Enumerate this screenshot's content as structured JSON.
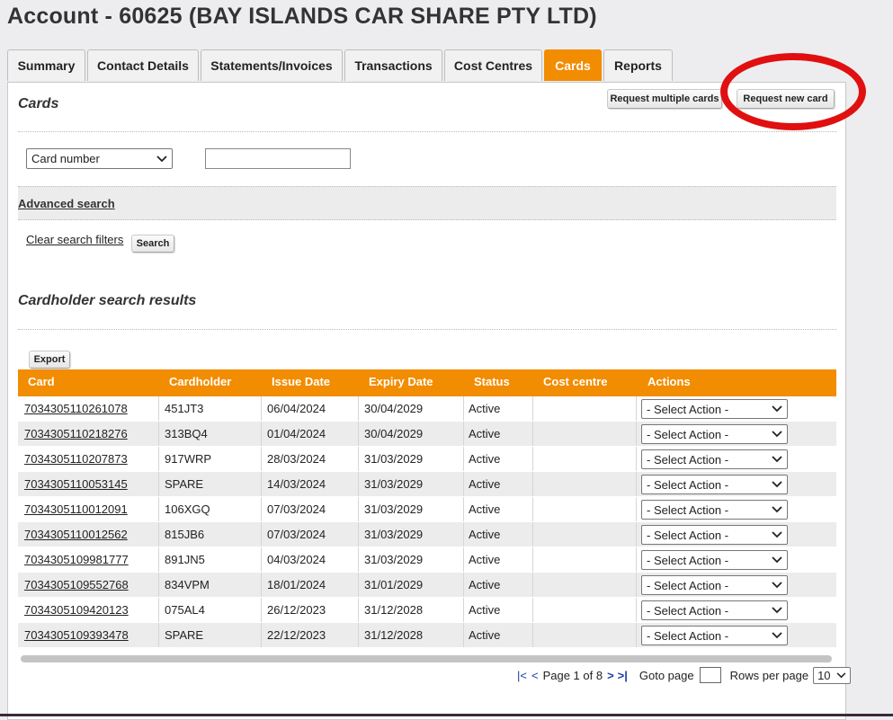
{
  "page_title": "Account - 60625 (BAY ISLANDS CAR SHARE PTY LTD)",
  "tabs": [
    {
      "label": "Summary",
      "active": false
    },
    {
      "label": "Contact Details",
      "active": false
    },
    {
      "label": "Statements/Invoices",
      "active": false
    },
    {
      "label": "Transactions",
      "active": false
    },
    {
      "label": "Cost Centres",
      "active": false
    },
    {
      "label": "Cards",
      "active": true
    },
    {
      "label": "Reports",
      "active": false
    }
  ],
  "cards_section": {
    "heading": "Cards",
    "request_multiple_label": "Request multiple cards",
    "request_new_label": "Request new card"
  },
  "search": {
    "field_select_value": "Card number",
    "input_value": "",
    "advanced_search_label": "Advanced search",
    "clear_filters_label": "Clear search filters",
    "search_button_label": "Search"
  },
  "results": {
    "heading": "Cardholder search results",
    "export_label": "Export",
    "columns": [
      "Card",
      "Cardholder",
      "Issue Date",
      "Expiry Date",
      "Status",
      "Cost centre",
      "Actions"
    ],
    "action_placeholder": "- Select Action -",
    "rows": [
      {
        "card": "7034305110261078",
        "cardholder": "451JT3",
        "issue": "06/04/2024",
        "expiry": "30/04/2029",
        "status": "Active",
        "cost_centre": ""
      },
      {
        "card": "7034305110218276",
        "cardholder": "313BQ4",
        "issue": "01/04/2024",
        "expiry": "30/04/2029",
        "status": "Active",
        "cost_centre": ""
      },
      {
        "card": "7034305110207873",
        "cardholder": "917WRP",
        "issue": "28/03/2024",
        "expiry": "31/03/2029",
        "status": "Active",
        "cost_centre": ""
      },
      {
        "card": "7034305110053145",
        "cardholder": "SPARE",
        "issue": "14/03/2024",
        "expiry": "31/03/2029",
        "status": "Active",
        "cost_centre": ""
      },
      {
        "card": "7034305110012091",
        "cardholder": "106XGQ",
        "issue": "07/03/2024",
        "expiry": "31/03/2029",
        "status": "Active",
        "cost_centre": ""
      },
      {
        "card": "7034305110012562",
        "cardholder": "815JB6",
        "issue": "07/03/2024",
        "expiry": "31/03/2029",
        "status": "Active",
        "cost_centre": ""
      },
      {
        "card": "7034305109981777",
        "cardholder": "891JN5",
        "issue": "04/03/2024",
        "expiry": "31/03/2029",
        "status": "Active",
        "cost_centre": ""
      },
      {
        "card": "7034305109552768",
        "cardholder": "834VPM",
        "issue": "18/01/2024",
        "expiry": "31/01/2029",
        "status": "Active",
        "cost_centre": ""
      },
      {
        "card": "7034305109420123",
        "cardholder": "075AL4",
        "issue": "26/12/2023",
        "expiry": "31/12/2028",
        "status": "Active",
        "cost_centre": ""
      },
      {
        "card": "7034305109393478",
        "cardholder": "SPARE",
        "issue": "22/12/2023",
        "expiry": "31/12/2028",
        "status": "Active",
        "cost_centre": ""
      }
    ]
  },
  "pagination": {
    "first": "|<",
    "prev": "<",
    "page_info": "Page 1 of 8",
    "next": ">",
    "last": ">|",
    "goto_label": "Goto page",
    "rows_label": "Rows per page",
    "rows_value": "10"
  },
  "colors": {
    "accent": "#f28c00",
    "annotation": "#e01010"
  },
  "icons": {
    "select_arrow": "chevron-down-icon"
  }
}
